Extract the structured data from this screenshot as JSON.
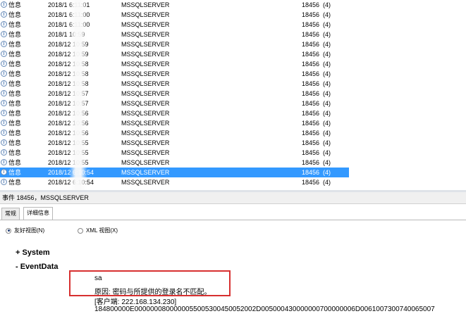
{
  "events": [
    {
      "level": "信息",
      "datetime": "2018/1 6:11:01",
      "source": "MSSQLSERVER",
      "event_id": "18456",
      "category": "(4)"
    },
    {
      "level": "信息",
      "datetime": "2018/1 6:11:00",
      "source": "MSSQLSERVER",
      "event_id": "18456",
      "category": "(4)"
    },
    {
      "level": "信息",
      "datetime": "2018/1 6:11:00",
      "source": "MSSQLSERVER",
      "event_id": "18456",
      "category": "(4)"
    },
    {
      "level": "信息",
      "datetime": "2018/1 10:59",
      "source": "MSSQLSERVER",
      "event_id": "18456",
      "category": "(4)"
    },
    {
      "level": "信息",
      "datetime": "2018/12 10:59",
      "source": "MSSQLSERVER",
      "event_id": "18456",
      "category": "(4)"
    },
    {
      "level": "信息",
      "datetime": "2018/12 10:59",
      "source": "MSSQLSERVER",
      "event_id": "18456",
      "category": "(4)"
    },
    {
      "level": "信息",
      "datetime": "2018/12 10:58",
      "source": "MSSQLSERVER",
      "event_id": "18456",
      "category": "(4)"
    },
    {
      "level": "信息",
      "datetime": "2018/12 10:58",
      "source": "MSSQLSERVER",
      "event_id": "18456",
      "category": "(4)"
    },
    {
      "level": "信息",
      "datetime": "2018/12 10:58",
      "source": "MSSQLSERVER",
      "event_id": "18456",
      "category": "(4)"
    },
    {
      "level": "信息",
      "datetime": "2018/12 10:57",
      "source": "MSSQLSERVER",
      "event_id": "18456",
      "category": "(4)"
    },
    {
      "level": "信息",
      "datetime": "2018/12 10:57",
      "source": "MSSQLSERVER",
      "event_id": "18456",
      "category": "(4)"
    },
    {
      "level": "信息",
      "datetime": "2018/12 10:56",
      "source": "MSSQLSERVER",
      "event_id": "18456",
      "category": "(4)"
    },
    {
      "level": "信息",
      "datetime": "2018/12 10:56",
      "source": "MSSQLSERVER",
      "event_id": "18456",
      "category": "(4)"
    },
    {
      "level": "信息",
      "datetime": "2018/12 10:56",
      "source": "MSSQLSERVER",
      "event_id": "18456",
      "category": "(4)"
    },
    {
      "level": "信息",
      "datetime": "2018/12 10:55",
      "source": "MSSQLSERVER",
      "event_id": "18456",
      "category": "(4)"
    },
    {
      "level": "信息",
      "datetime": "2018/12 10:55",
      "source": "MSSQLSERVER",
      "event_id": "18456",
      "category": "(4)"
    },
    {
      "level": "信息",
      "datetime": "2018/12 10:55",
      "source": "MSSQLSERVER",
      "event_id": "18456",
      "category": "(4)"
    },
    {
      "level": "信息",
      "datetime": "2018/12 6:10:54",
      "source": "MSSQLSERVER",
      "event_id": "18456",
      "category": "(4)",
      "selected": true
    },
    {
      "level": "信息",
      "datetime": "2018/12 6:10:54",
      "source": "MSSQLSERVER",
      "event_id": "18456",
      "category": "(4)"
    }
  ],
  "detail": {
    "title": "事件 18456，MSSQLSERVER",
    "tabs": [
      "常规",
      "详细信息"
    ],
    "view_friendly": "友好视图(N)",
    "view_xml": "XML 视图(X)",
    "section_system": "+ System",
    "section_eventdata": "- EventData",
    "line1": "sa",
    "line2": "原因: 密码与所提供的登录名不匹配。",
    "line3": "[客户端: 222.168.134.230]",
    "line4": "184800000E0000000800000055005300450052002D005000430000000700000006D0061007300740065007"
  },
  "colors": {
    "selection": "#3399ff",
    "highlight_box": "#d73030"
  },
  "icons": {
    "event_level": "info-icon"
  }
}
